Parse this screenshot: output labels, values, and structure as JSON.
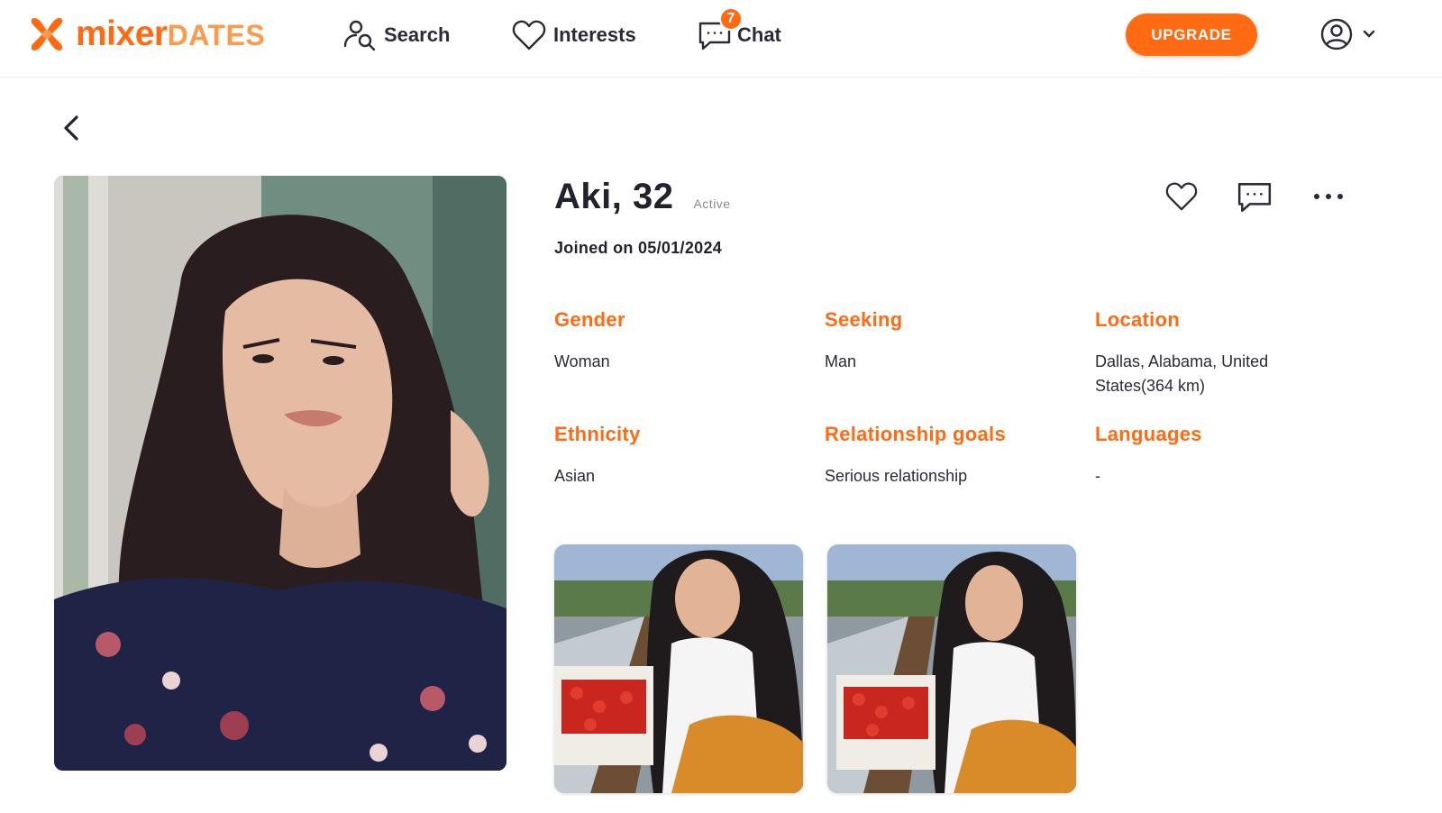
{
  "brand": {
    "name_part1": "mixer",
    "name_part2": "DATES",
    "accent_color": "#ff6a13"
  },
  "nav": {
    "items": [
      {
        "label": "Search",
        "icon": "search-user-icon"
      },
      {
        "label": "Interests",
        "icon": "heart-icon"
      },
      {
        "label": "Chat",
        "icon": "chat-icon",
        "badge": "7"
      }
    ],
    "upgrade_label": "UPGRADE",
    "account_icon": "user-circle-icon"
  },
  "profile": {
    "name_age": "Aki, 32",
    "status": "Active",
    "joined": "Joined on 05/01/2024",
    "actions": [
      "heart-icon",
      "chat-icon",
      "more-icon"
    ],
    "fields": [
      {
        "label": "Gender",
        "value": "Woman"
      },
      {
        "label": "Seeking",
        "value": "Man"
      },
      {
        "label": "Location",
        "value": "Dallas, Alabama, United States(364 km)"
      },
      {
        "label": "Ethnicity",
        "value": "Asian"
      },
      {
        "label": "Relationship goals",
        "value": "Serious relationship"
      },
      {
        "label": "Languages",
        "value": "-"
      }
    ]
  }
}
